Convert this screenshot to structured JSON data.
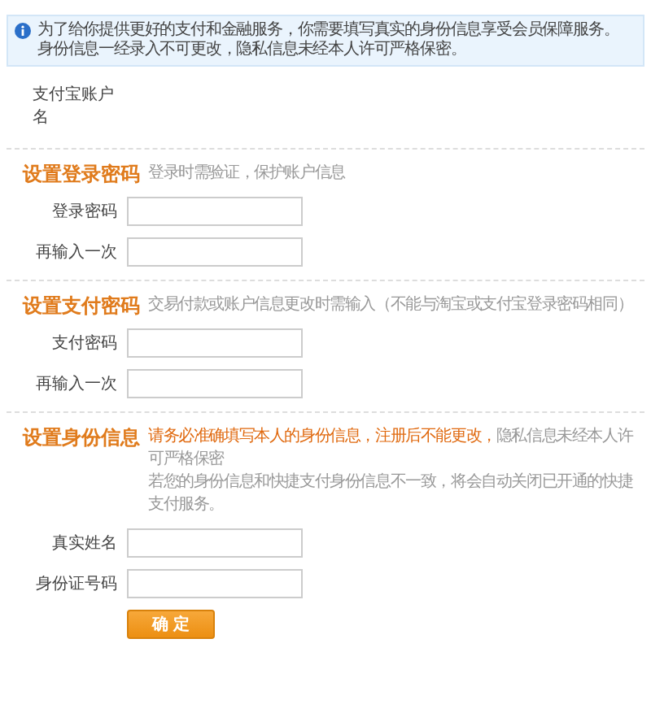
{
  "notice": {
    "lines": [
      "为了给你提供更好的支付和金融服务，你需要填写真实的身份信息享受会员保障服务。",
      "身份信息一经录入不可更改，隐私信息未经本人许可严格保密。"
    ]
  },
  "account": {
    "label": "支付宝账户名"
  },
  "sections": [
    {
      "title": "设置登录密码",
      "description": [
        {
          "kind": "plain",
          "text": "登录时需验证，保护账户信息"
        }
      ],
      "fields": [
        {
          "label": "登录密码"
        },
        {
          "label": "再输入一次"
        }
      ]
    },
    {
      "title": "设置支付密码",
      "description": [
        {
          "kind": "plain",
          "text": "交易付款或账户信息更改时需输入（不能与淘宝或支付宝登录密码相同）"
        }
      ],
      "fields": [
        {
          "label": "支付密码"
        },
        {
          "label": "再输入一次"
        }
      ]
    },
    {
      "title": "设置身份信息",
      "description": [
        {
          "kind": "warning",
          "text": "请务必准确填写本人的身份信息，注册后不能更改，"
        },
        {
          "kind": "plain",
          "text": "隐私信息未经本人许可严格保密"
        },
        {
          "kind": "break"
        },
        {
          "kind": "plain",
          "text": "若您的身份信息和快捷支付身份信息不一致，将会自动关闭已开通的快捷支付服务。"
        }
      ],
      "fields": [
        {
          "label": "真实姓名"
        },
        {
          "label": "身份证号码"
        }
      ]
    }
  ],
  "submit": {
    "label": "确 定"
  }
}
